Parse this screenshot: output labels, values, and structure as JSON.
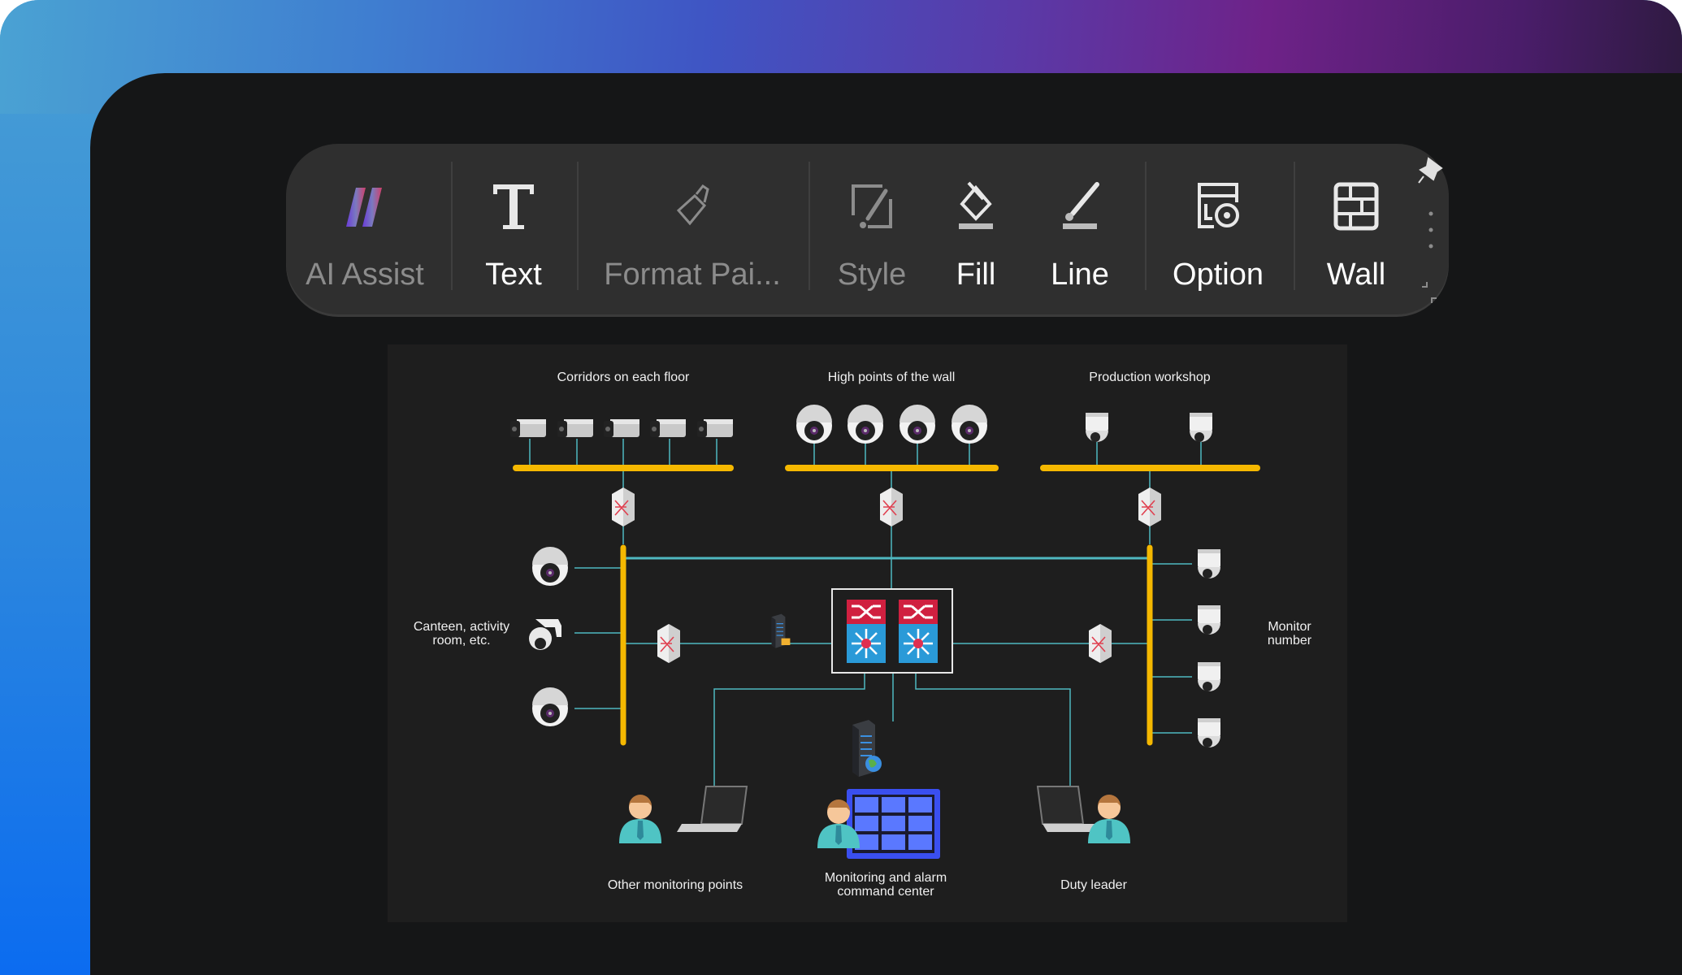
{
  "toolbar": {
    "items": [
      {
        "label": "AI Assist",
        "icon": "ai-assist-icon",
        "enabled": false
      },
      {
        "label": "Text",
        "icon": "text-icon",
        "enabled": true
      },
      {
        "label": "Format Pai...",
        "icon": "format-painter-icon",
        "enabled": false
      },
      {
        "label": "Style",
        "icon": "style-icon",
        "enabled": false
      },
      {
        "label": "Fill",
        "icon": "fill-bucket-icon",
        "enabled": true
      },
      {
        "label": "Line",
        "icon": "line-pen-icon",
        "enabled": true
      },
      {
        "label": "Option",
        "icon": "option-icon",
        "enabled": true
      },
      {
        "label": "Wall",
        "icon": "wall-icon",
        "enabled": true
      }
    ],
    "pin_icon": "pin-icon",
    "more_icon": "more-vertical-icon"
  },
  "diagram": {
    "labels": {
      "corridors": "Corridors on each floor",
      "high_points": "High points of the wall",
      "workshop": "Production workshop",
      "canteen_1": "Canteen, activity",
      "canteen_2": "room, etc.",
      "monitor_1": "Monitor",
      "monitor_2": "number",
      "other_points": "Other monitoring points",
      "center_1": "Monitoring and alarm",
      "center_2": "command center",
      "duty_leader": "Duty leader"
    },
    "colors": {
      "cable": "#4fb8c0",
      "bus": "#f5b800",
      "background": "#1e1e1e"
    }
  }
}
